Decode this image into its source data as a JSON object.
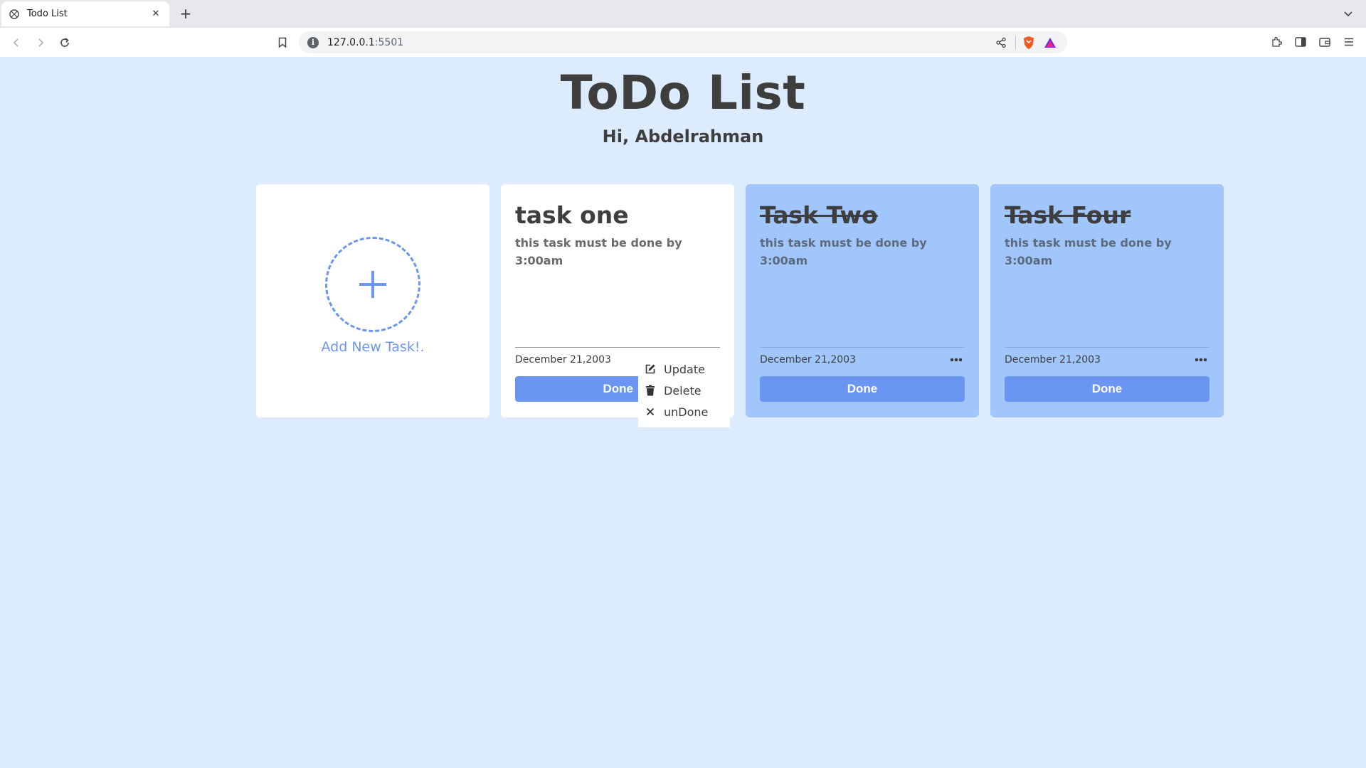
{
  "browser": {
    "tab_title": "Todo List",
    "new_tab_symbol": "+",
    "url_host": "127.0.0.1",
    "url_port": ":5501"
  },
  "page": {
    "title": "ToDo List",
    "greeting": "Hi, Abdelrahman",
    "add_label": "Add New Task!."
  },
  "tasks": [
    {
      "title": "task one",
      "description": "this task must be done by 3:00am",
      "date": "December 21,2003",
      "button": "Done",
      "done": false
    },
    {
      "title": "Task Two",
      "description": "this task must be done by 3:00am",
      "date": "December 21,2003",
      "button": "Done",
      "done": true
    },
    {
      "title": "Task Four",
      "description": "this task must be done by 3:00am",
      "date": "December 21,2003",
      "button": "Done",
      "done": true
    }
  ],
  "menu": {
    "items": [
      {
        "label": "Update",
        "icon": "edit-icon"
      },
      {
        "label": "Delete",
        "icon": "trash-icon"
      },
      {
        "label": "unDone",
        "icon": "close-icon"
      }
    ]
  },
  "colors": {
    "page_bg": "#dcebfd",
    "accent": "#6a96f2",
    "done_card": "#a1c6fc",
    "text": "#3e3e3e"
  }
}
